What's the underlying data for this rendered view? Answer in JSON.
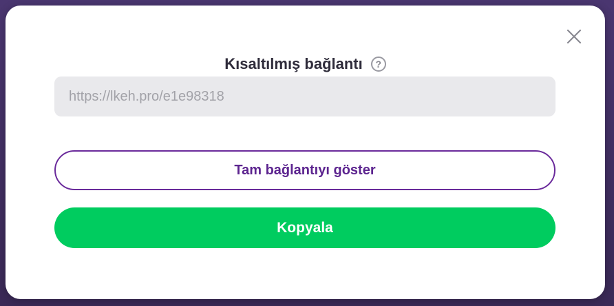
{
  "modal": {
    "title": "Kısaltılmış bağlantı",
    "help_icon": "question-icon",
    "close_icon": "close-icon",
    "short_link": "https://lkeh.pro/e1e98318",
    "show_full_link_label": "Tam bağlantıyı göster",
    "copy_label": "Kopyala"
  },
  "colors": {
    "primary_green": "#00cc5f",
    "accent_purple": "#5c248f",
    "field_bg": "#e9e9ec"
  }
}
